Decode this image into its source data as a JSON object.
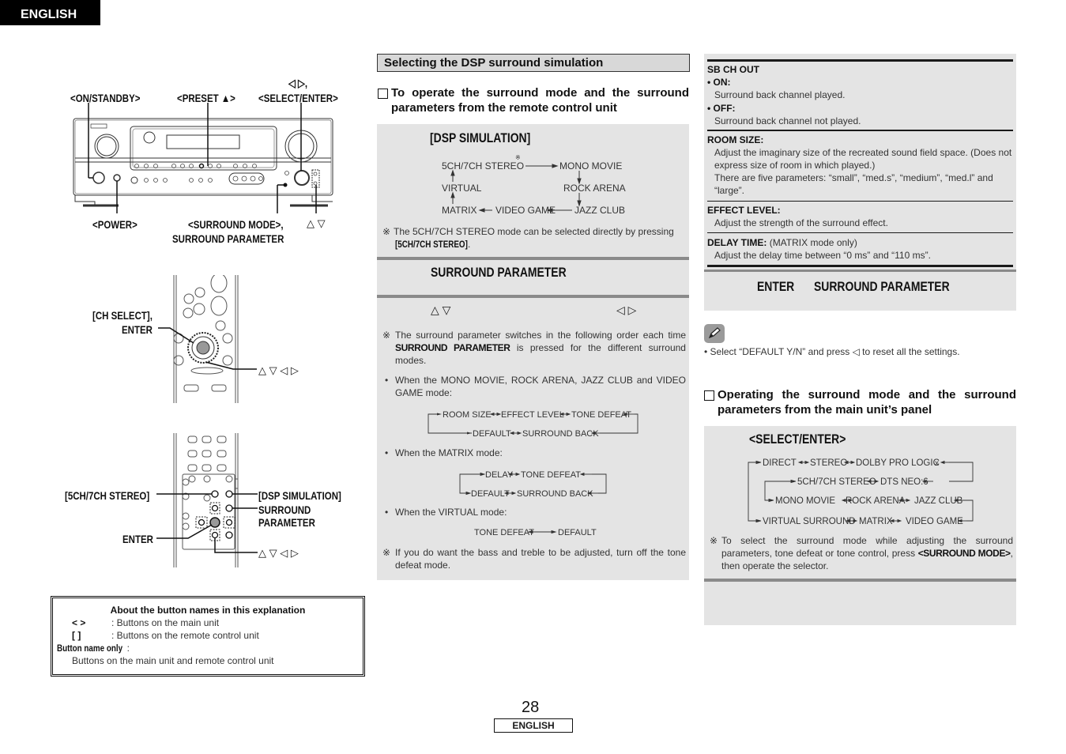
{
  "header": {
    "language_tab": "ENGLISH"
  },
  "figure_main_unit": {
    "labels": {
      "on_standby": "<ON/STANDBY>",
      "preset": "<PRESET ▲>",
      "select_arrows": "◁ ▷,",
      "select_enter": "<SELECT/ENTER>",
      "power": "<POWER>",
      "surround_mode": "<SURROUND MODE>,",
      "surround_parameter": "SURROUND PARAMETER",
      "up_down": "△ ▽"
    }
  },
  "figure_remote_1": {
    "labels": {
      "ch_select": "[CH SELECT],",
      "enter": "ENTER",
      "arrows": "△ ▽ ◁ ▷"
    }
  },
  "figure_remote_2": {
    "labels": {
      "stereo": "[5CH/7CH STEREO]",
      "dsp_simulation": "[DSP SIMULATION]",
      "surround": "SURROUND",
      "parameter": "PARAMETER",
      "enter": "ENTER",
      "arrows": "△ ▽ ◁ ▷"
    }
  },
  "info_box": {
    "title": "About the button names in this explanation",
    "rows": [
      {
        "symbol": "<    >",
        "text": ": Buttons on the main unit"
      },
      {
        "symbol": "[     ]",
        "text": ": Buttons on the remote control unit"
      }
    ],
    "button_name_only_label": "Button name only",
    "button_name_only_colon": " :",
    "button_name_only_text": "Buttons on the main unit and remote control unit"
  },
  "middle": {
    "section_title": "Selecting the DSP surround simulation",
    "subhead": "To operate the surround mode and the surround parameters from the remote control unit",
    "dsp_box": {
      "title": "[DSP SIMULATION]",
      "cycle": {
        "stereo": "5CH/7CH STEREO",
        "mono_movie": "MONO MOVIE",
        "virtual": "VIRTUAL",
        "rock_arena": "ROCK ARENA",
        "matrix": "MATRIX",
        "video_game": "VIDEO GAME",
        "jazz_club": "JAZZ CLUB",
        "mark": "※"
      },
      "note_mark": "※",
      "note_text": "The 5CH/7CH STEREO mode can be selected directly by pressing ",
      "note_bold": "[5CH/7CH STEREO]",
      "note_end": "."
    },
    "surround_param_box": {
      "title": "SURROUND PARAMETER"
    },
    "arrows_left": "△ ▽",
    "arrows_right": "◁ ▷",
    "param_note": {
      "mark": "※",
      "text_a": "The surround parameter switches in the following order each time ",
      "bold": "SURROUND PARAMETER",
      "text_b": " is pressed for the different surround modes."
    },
    "bullet_mono": "When the MONO MOVIE, ROCK ARENA, JAZZ CLUB and VIDEO GAME mode:",
    "cycle_mono": {
      "room_size": "ROOM SIZE",
      "effect_level": "EFFECT LEVEL",
      "tone_defeat": "TONE DEFEAT",
      "default": "DEFAULT",
      "surround_back": "SURROUND BACK"
    },
    "bullet_matrix": "When the MATRIX mode:",
    "cycle_matrix": {
      "delay": "DELAY",
      "tone_defeat": "TONE DEFEAT",
      "default": "DEFAULT",
      "surround_back": "SURROUND BACK"
    },
    "bullet_virtual": "When the VIRTUAL mode:",
    "cycle_virtual": {
      "tone_defeat": "TONE DEFEAT",
      "default": "DEFAULT"
    },
    "tone_note_mark": "※",
    "tone_note": "If you do want the bass and treble to be adjusted, turn off the tone defeat mode."
  },
  "right": {
    "params": [
      {
        "title": "SB CH OUT",
        "items": [
          {
            "label": "• ON:",
            "text": "Surround back channel played."
          },
          {
            "label": "• OFF:",
            "text": "Surround back channel not played."
          }
        ]
      }
    ],
    "room_size": {
      "title": "ROOM SIZE:",
      "text1": "Adjust the imaginary size of the recreated sound field space. (Does not express size of room in which played.)",
      "text2": "There are five parameters: “small”, “med.s”, “medium”, “med.l” and “large”."
    },
    "effect_level": {
      "title": "EFFECT LEVEL:",
      "text": "Adjust the strength of the surround effect."
    },
    "delay_time": {
      "title": "DELAY TIME:",
      "qualifier": " (MATRIX mode only)",
      "text": "Adjust the delay time between “0 ms” and “110 ms”."
    },
    "enter_box": {
      "enter": "ENTER",
      "title": "SURROUND PARAMETER"
    },
    "pencil_icon": "pencil-icon",
    "tip": "• Select “DEFAULT Y/N” and press ◁ to reset all the settings.",
    "subhead": "Operating the surround mode and the surround parameters from the main unit’s panel",
    "select_box": {
      "title": "<SELECT/ENTER>",
      "row1": [
        "DIRECT",
        "STEREO",
        "DOLBY PRO LOGIC",
        "x"
      ],
      "row2": [
        "5CH/7CH STEREO",
        "DTS NEO:6"
      ],
      "row3": [
        "MONO MOVIE",
        "ROCK ARENA",
        "JAZZ CLUB"
      ],
      "row4": [
        "VIRTUAL SURROUND",
        "MATRIX",
        "VIDEO GAME"
      ],
      "note_mark": "※",
      "note_a": "To select the surround mode while adjusting the surround parameters, tone defeat or tone control, press ",
      "note_bold": "<SURROUND MODE>",
      "note_b": ", then operate the selector."
    }
  },
  "footer": {
    "page_number": "28",
    "language": "ENGLISH"
  }
}
